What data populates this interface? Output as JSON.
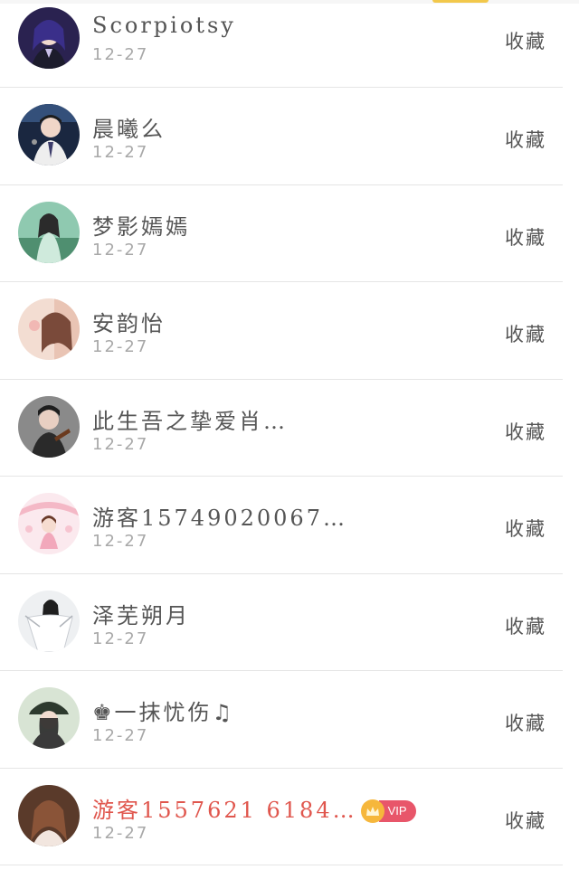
{
  "header": {
    "accent_color": "#f2c84b"
  },
  "rows": [
    {
      "name": "Scorpiotsy",
      "date": "12-27",
      "action": "收藏",
      "vip": false
    },
    {
      "name": "晨曦么",
      "date": "12-27",
      "action": "收藏",
      "vip": false
    },
    {
      "name": "梦影嫣嫣",
      "date": "12-27",
      "action": "收藏",
      "vip": false
    },
    {
      "name": "安韵怡",
      "date": "12-27",
      "action": "收藏",
      "vip": false
    },
    {
      "name": "此生吾之挚爱肖…",
      "date": "12-27",
      "action": "收藏",
      "vip": false
    },
    {
      "name": "游客15749020067…",
      "date": "12-27",
      "action": "收藏",
      "vip": false
    },
    {
      "name": "泽芜朔月",
      "date": "12-27",
      "action": "收藏",
      "vip": false
    },
    {
      "name": "♚一抹忧伤♫",
      "date": "12-27",
      "action": "收藏",
      "vip": false
    },
    {
      "name": "游客1557621 6184…",
      "date": "12-27",
      "action": "收藏",
      "vip": true,
      "vip_label": "VIP"
    }
  ],
  "colors": {
    "name_text": "#555555",
    "vip_name_text": "#e0564d",
    "date_text": "#a8a8a8",
    "divider": "#e5e5e5",
    "vip_badge": "#e8566a",
    "vip_crown": "#f6b73c"
  }
}
